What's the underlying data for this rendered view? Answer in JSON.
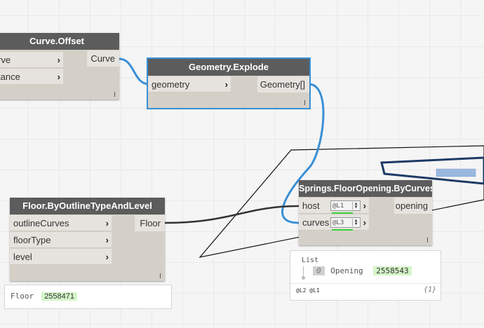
{
  "nodes": {
    "curve_offset": {
      "title": "Curve.Offset",
      "inputs": [
        "rve",
        "tance"
      ],
      "output": "Curve"
    },
    "geometry_explode": {
      "title": "Geometry.Explode",
      "inputs": [
        "geometry"
      ],
      "output": "Geometry[]"
    },
    "floor_by_outline": {
      "title": "Floor.ByOutlineTypeAndLevel",
      "inputs": [
        "outlineCurves",
        "floorType",
        "level"
      ],
      "output": "Floor"
    },
    "springs_opening": {
      "title": "Springs.FloorOpening.ByCurves",
      "inputs": [
        "host",
        "curves"
      ],
      "input_levels": [
        "@L1",
        "@L3"
      ],
      "output": "opening"
    }
  },
  "previews": {
    "floor_preview": {
      "label": "Floor",
      "value": "2558471"
    },
    "opening_preview": {
      "list_label": "List",
      "index": "0",
      "item_label": "Opening",
      "item_value": "2558543",
      "levels": "@L2 @L1",
      "count": "{1}"
    }
  },
  "colors": {
    "wire": "#3a8fd6",
    "node_header": "#5c5c5c",
    "selection": "#3a8fd6",
    "value_highlight": "#d4f5c9",
    "level_underline": "#3bd13b"
  }
}
